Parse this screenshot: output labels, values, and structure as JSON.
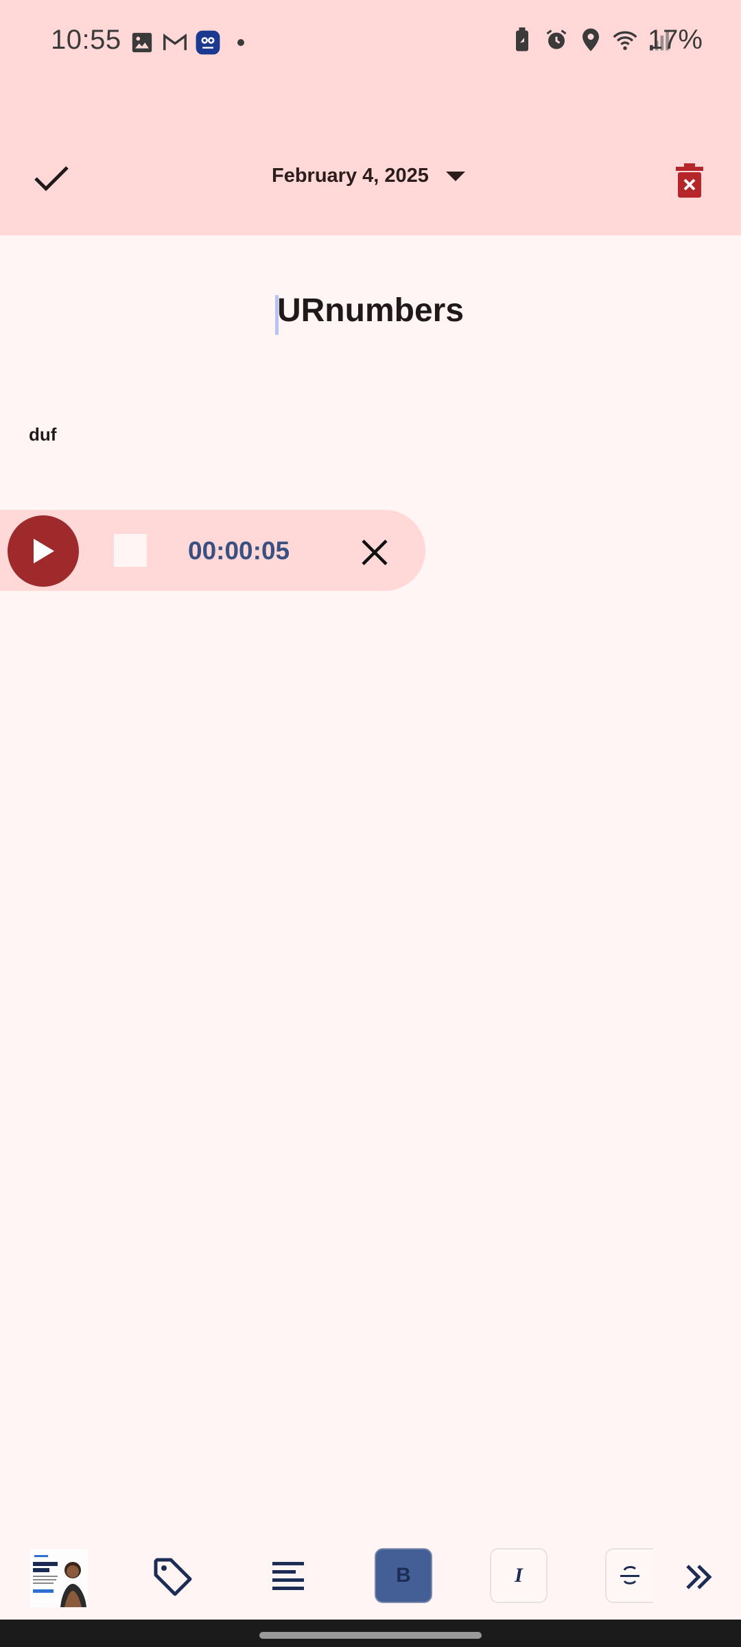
{
  "status_bar": {
    "time": "10:55",
    "battery": "17%",
    "left_icons": [
      "gallery-icon",
      "gmail-icon",
      "app-icon",
      "dot-icon"
    ],
    "right_icons": [
      "battery-saver-icon",
      "alarm-icon",
      "location-icon",
      "wifi-icon",
      "signal-icon"
    ]
  },
  "toolbar": {
    "date": "February 4, 2025",
    "confirm_icon": "check-icon",
    "delete_icon": "trash-icon"
  },
  "note": {
    "title": "URnumbers",
    "body": "duf"
  },
  "audio_player": {
    "elapsed": "00:00:05"
  },
  "bottom_toolbar": {
    "bold_label": "B",
    "italic_label": "I",
    "items": [
      "image-thumbnail",
      "tag-icon",
      "align-icon",
      "bold-button",
      "italic-button",
      "strikethrough-button",
      "more-icon"
    ]
  },
  "colors": {
    "header_bg": "#ffd8d7",
    "page_bg": "#fff5f4",
    "accent_red": "#9e2a2b",
    "navy": "#1c2d55",
    "timer_blue": "#3a5081"
  }
}
